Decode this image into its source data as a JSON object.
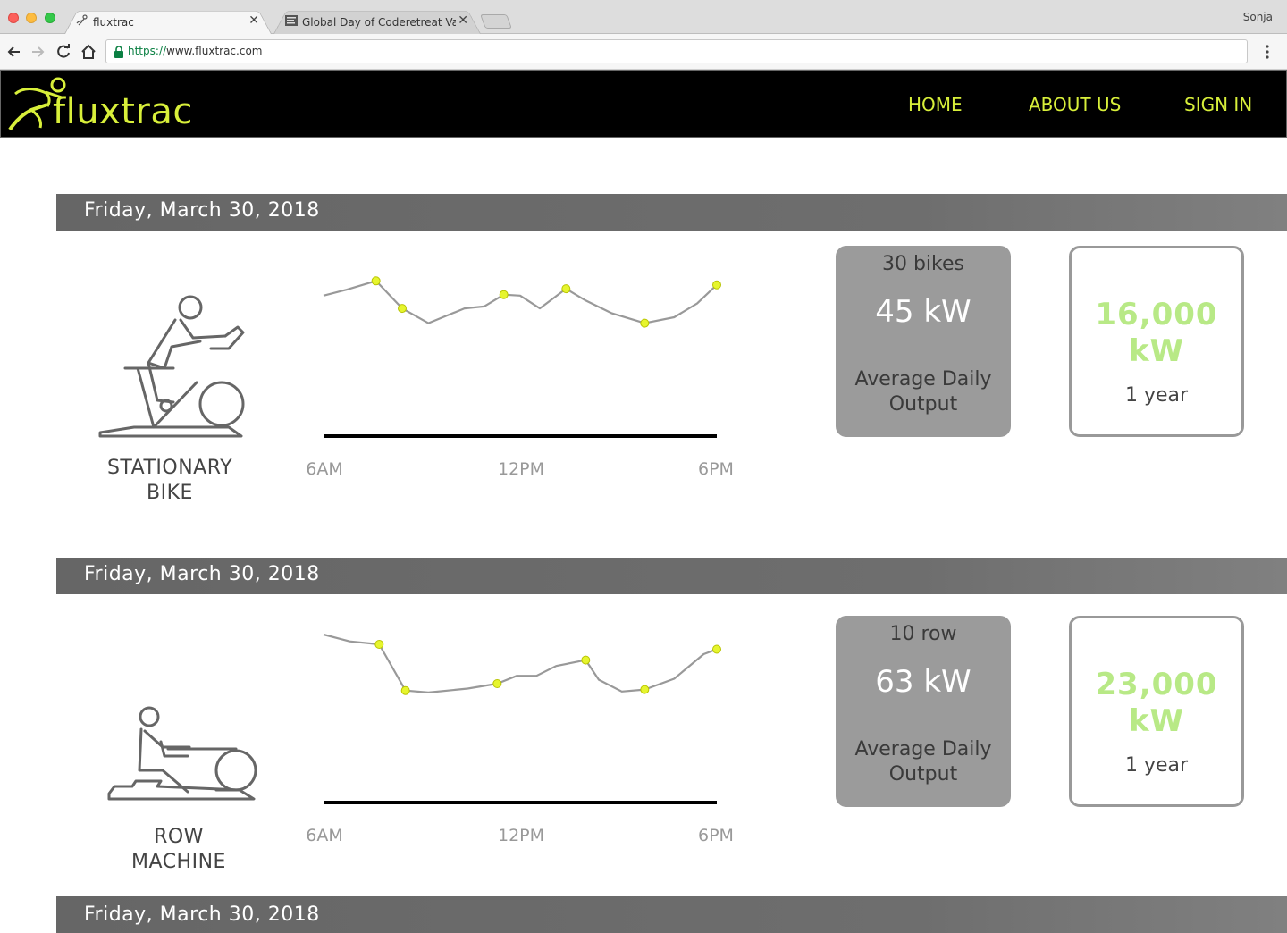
{
  "browser": {
    "tabs": [
      {
        "title": "fluxtrac",
        "active": true
      },
      {
        "title": "Global Day of Coderetreat Val",
        "active": false
      }
    ],
    "profile": "Sonja",
    "url_scheme": "https://",
    "url_rest": "www.fluxtrac.com"
  },
  "site": {
    "logo_text": "fluxtrac",
    "nav": [
      "HOME",
      "ABOUT US",
      "SIGN IN"
    ],
    "accent": "#d8ef3a"
  },
  "sections": [
    {
      "date": "Friday, March 30, 2018",
      "equipment_line1": "STATIONARY",
      "equipment_line2": "BIKE",
      "icon": "stationary-bike-icon",
      "count": "30 bikes",
      "avg_kw": "45 kW",
      "avg_line1": "Average Daily",
      "avg_line2": "Output",
      "total_line1": "16,000",
      "total_line2": "kW",
      "period": "1 year"
    },
    {
      "date": "Friday, March 30, 2018",
      "equipment_line1": "ROW",
      "equipment_line2": "MACHINE",
      "icon": "row-machine-icon",
      "count": "10 row",
      "avg_kw": "63 kW",
      "avg_line1": "Average Daily",
      "avg_line2": "Output",
      "total_line1": "23,000",
      "total_line2": "kW",
      "period": "1 year"
    },
    {
      "date": "Friday, March 30, 2018"
    }
  ],
  "chart_data": [
    {
      "type": "line",
      "title": "",
      "xlabel": "",
      "ylabel": "",
      "x_ticks": [
        "6AM",
        "12PM",
        "6PM"
      ],
      "xlim": [
        6,
        18
      ],
      "ylim": [
        0,
        100
      ],
      "x": [
        6,
        6.7,
        7.6,
        8.4,
        9.2,
        10.3,
        10.9,
        11.5,
        12,
        12.6,
        13.4,
        14,
        14.8,
        15.8,
        16.7,
        17.4,
        18
      ],
      "values": [
        72,
        78,
        87,
        59,
        44,
        59,
        61,
        73,
        72,
        59,
        79,
        67,
        54,
        44,
        50,
        64,
        83,
        90
      ],
      "highlight_indices": [
        2,
        3,
        7,
        10,
        13,
        16
      ],
      "line_color": "#999999",
      "marker_color": "#e6f52e"
    },
    {
      "type": "line",
      "title": "",
      "xlabel": "",
      "ylabel": "",
      "x_ticks": [
        "6AM",
        "12PM",
        "6PM"
      ],
      "xlim": [
        6,
        18
      ],
      "ylim": [
        0,
        100
      ],
      "x": [
        6,
        6.8,
        7.7,
        8.5,
        9.2,
        10.4,
        11.3,
        11.9,
        12.5,
        13.1,
        14,
        14.4,
        15.1,
        15.8,
        16.7,
        17.6,
        18
      ],
      "values": [
        100,
        93,
        90,
        43,
        41,
        45,
        50,
        58,
        58,
        68,
        74,
        54,
        42,
        44,
        55,
        80,
        85
      ],
      "highlight_indices": [
        2,
        3,
        6,
        10,
        13,
        16
      ],
      "line_color": "#999999",
      "marker_color": "#e6f52e"
    }
  ]
}
